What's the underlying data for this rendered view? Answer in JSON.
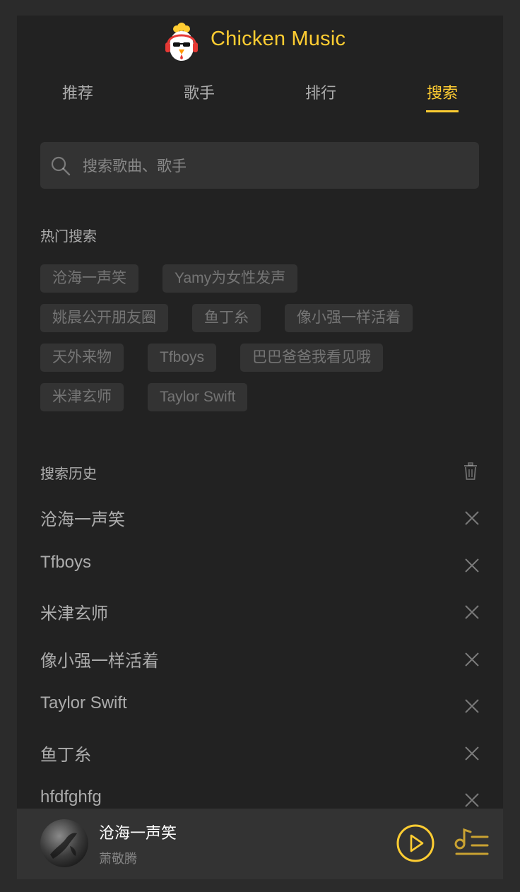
{
  "header": {
    "title": "Chicken Music"
  },
  "tabs": [
    {
      "label": "推荐",
      "active": false
    },
    {
      "label": "歌手",
      "active": false
    },
    {
      "label": "排行",
      "active": false
    },
    {
      "label": "搜索",
      "active": true
    }
  ],
  "search": {
    "placeholder": "搜索歌曲、歌手",
    "value": ""
  },
  "hot": {
    "title": "热门搜索",
    "rows": [
      [
        "沧海一声笑",
        "Yamy为女性发声"
      ],
      [
        "姚晨公开朋友圈",
        "鱼丁糸",
        "像小强一样活着"
      ],
      [
        "天外来物",
        "Tfboys",
        "巴巴爸爸我看见哦"
      ],
      [
        "米津玄师",
        "Taylor Swift"
      ]
    ]
  },
  "history": {
    "title": "搜索历史",
    "items": [
      "沧海一声笑",
      "Tfboys",
      "米津玄师",
      "像小强一样活着",
      "Taylor Swift",
      "鱼丁糸",
      "hfdfghfg"
    ]
  },
  "player": {
    "song": "沧海一声笑",
    "singer": "萧敬腾"
  },
  "colors": {
    "accent": "#ffcd32",
    "background": "#222222",
    "surface": "#333333"
  },
  "icons": [
    "logo-icon",
    "search-icon",
    "trash-icon",
    "close-icon",
    "play-icon",
    "playlist-icon"
  ]
}
